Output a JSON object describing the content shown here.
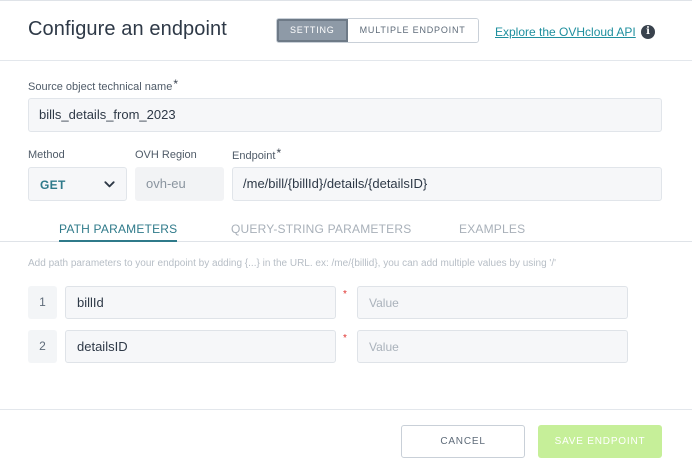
{
  "header": {
    "title": "Configure an endpoint",
    "mode_tabs": [
      "SETTING",
      "MULTIPLE ENDPOINT"
    ],
    "active_mode": "SETTING",
    "api_link": "Explore the OVHcloud API",
    "info_icon": "info-icon"
  },
  "source": {
    "label": "Source object technical name",
    "required_mark": "*",
    "value": "bills_details_from_2023"
  },
  "method": {
    "label": "Method",
    "value": "GET",
    "icon": "chevron-down-icon"
  },
  "region": {
    "label": "OVH Region",
    "value": "ovh-eu"
  },
  "endpoint": {
    "label": "Endpoint",
    "required_mark": "*",
    "value": "/me/bill/{billId}/details/{detailsID}"
  },
  "tabs": [
    {
      "label": "PATH PARAMETERS",
      "active": true
    },
    {
      "label": "QUERY-STRING PARAMETERS",
      "active": false
    },
    {
      "label": "EXAMPLES",
      "active": false
    }
  ],
  "path_hint": "Add path parameters to your endpoint by adding {...} in the URL. ex: /me/{billid}, you can add multiple values by using '/'",
  "params": [
    {
      "index": "1",
      "name": "billId",
      "required_mark": "*",
      "value_placeholder": "Value"
    },
    {
      "index": "2",
      "name": "detailsID",
      "required_mark": "*",
      "value_placeholder": "Value"
    }
  ],
  "footer": {
    "cancel_label": "CANCEL",
    "save_label": "SAVE ENDPOINT"
  },
  "colors": {
    "accent": "#2f7a8a",
    "link": "#1e8f9e",
    "save_disabled": "#c6ef99",
    "required_star": "#e0322f"
  }
}
